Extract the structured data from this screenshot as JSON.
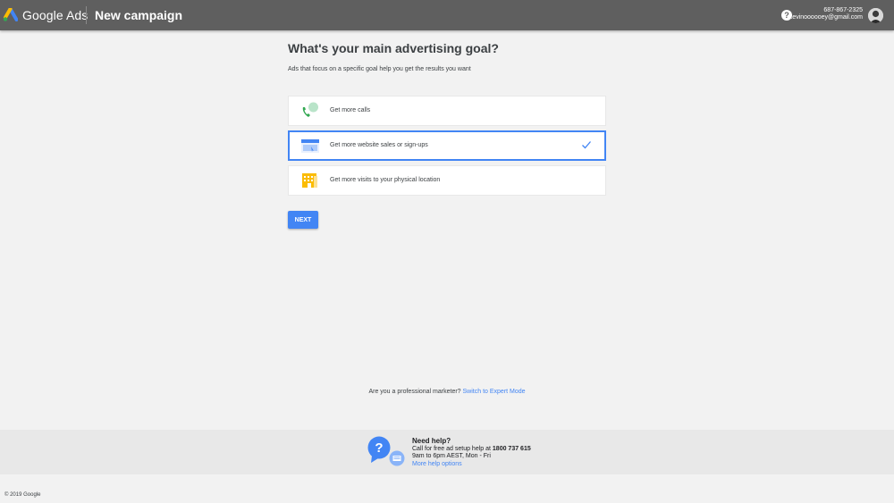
{
  "header": {
    "brand": "Google Ads",
    "page_title": "New campaign",
    "help_icon": "help-circle-icon",
    "account_phone": "687-867-2325",
    "account_email": "kevinoooooey@gmail.com"
  },
  "main": {
    "title": "What's your main advertising goal?",
    "subtitle": "Ads that focus on a specific goal help you get the results you want",
    "goals": [
      {
        "label": "Get more calls",
        "icon": "phone-call-icon",
        "selected": false
      },
      {
        "label": "Get more website sales or sign-ups",
        "icon": "website-icon",
        "selected": true
      },
      {
        "label": "Get more visits to your physical location",
        "icon": "storefront-icon",
        "selected": false
      }
    ],
    "next_label": "NEXT",
    "expert_prompt": "Are you a professional marketer?",
    "expert_link": "Switch to Expert Mode"
  },
  "help": {
    "heading": "Need help?",
    "call_text": "Call for free ad setup help at",
    "phone": "1800 737 615",
    "hours": "9am to 6pm AEST, Mon - Fri",
    "more_link": "More help options"
  },
  "footer": {
    "copyright": "© 2019 Google"
  },
  "colors": {
    "header_bg": "#5f5f5f",
    "accent": "#4285f4",
    "page_bg": "#f2f2f2"
  }
}
